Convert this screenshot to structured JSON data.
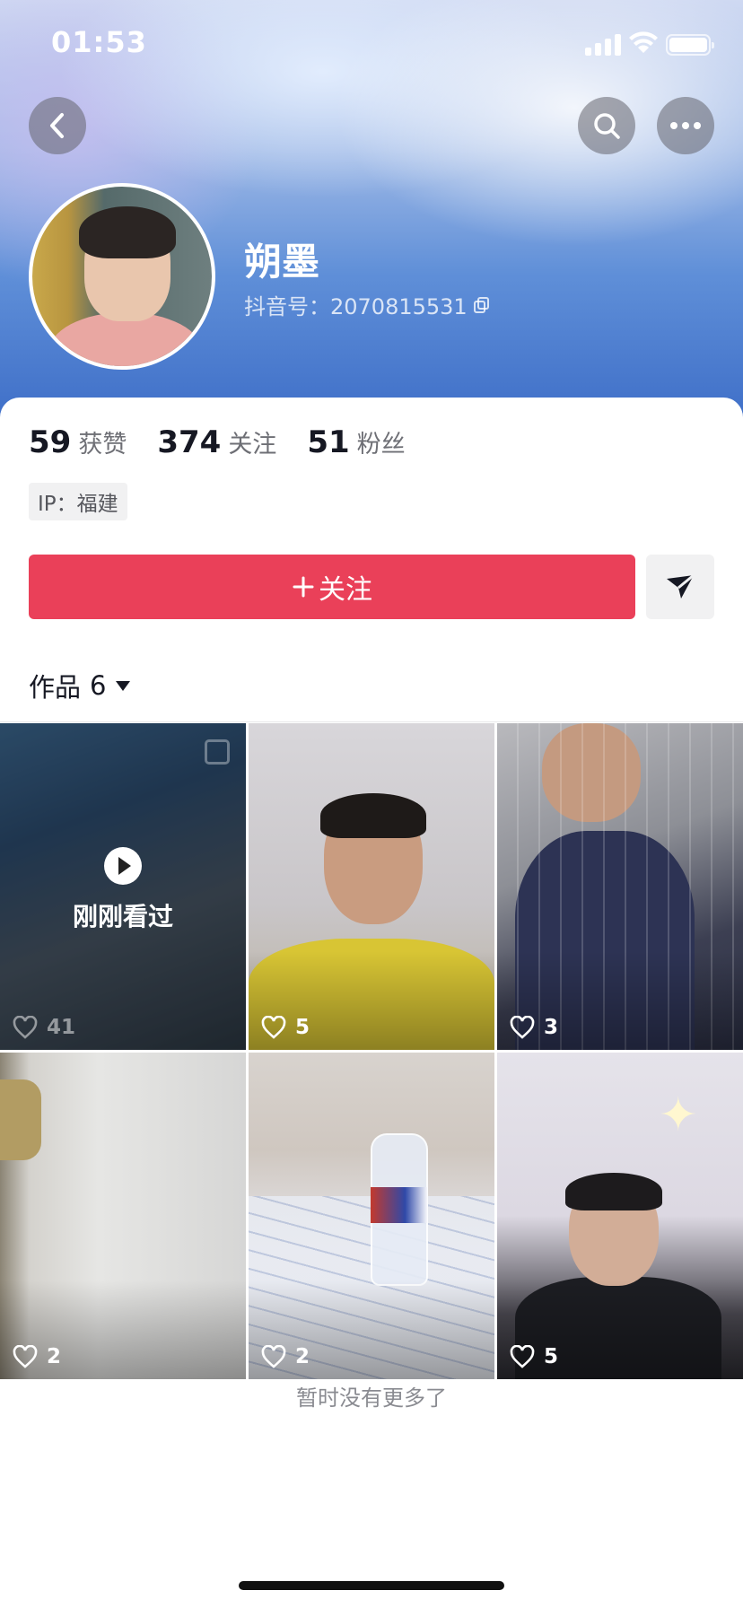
{
  "status_bar": {
    "time": "01:53"
  },
  "profile": {
    "nickname": "朔墨",
    "douyin_id": "抖音号：2070815531",
    "ip": "IP：福建"
  },
  "stats": [
    {
      "value": "59",
      "label": "获赞"
    },
    {
      "value": "374",
      "label": "关注"
    },
    {
      "value": "51",
      "label": "粉丝"
    }
  ],
  "actions": {
    "follow_label": "关注"
  },
  "works_tab": {
    "label": "作品",
    "count": "6"
  },
  "videos": [
    {
      "likes": "41",
      "badge": "刚刚看过"
    },
    {
      "likes": "5"
    },
    {
      "likes": "3"
    },
    {
      "likes": "2"
    },
    {
      "likes": "2"
    },
    {
      "likes": "5"
    }
  ],
  "footer": {
    "no_more": "暂时没有更多了"
  },
  "colors": {
    "follow_button": "#ea4059",
    "text_primary": "#161823",
    "text_secondary": "#6e6f75"
  },
  "icons": [
    "back-icon",
    "search-icon",
    "more-icon",
    "copy-icon",
    "plus-icon",
    "send-icon",
    "caret-down-icon",
    "heart-icon",
    "play-icon"
  ]
}
